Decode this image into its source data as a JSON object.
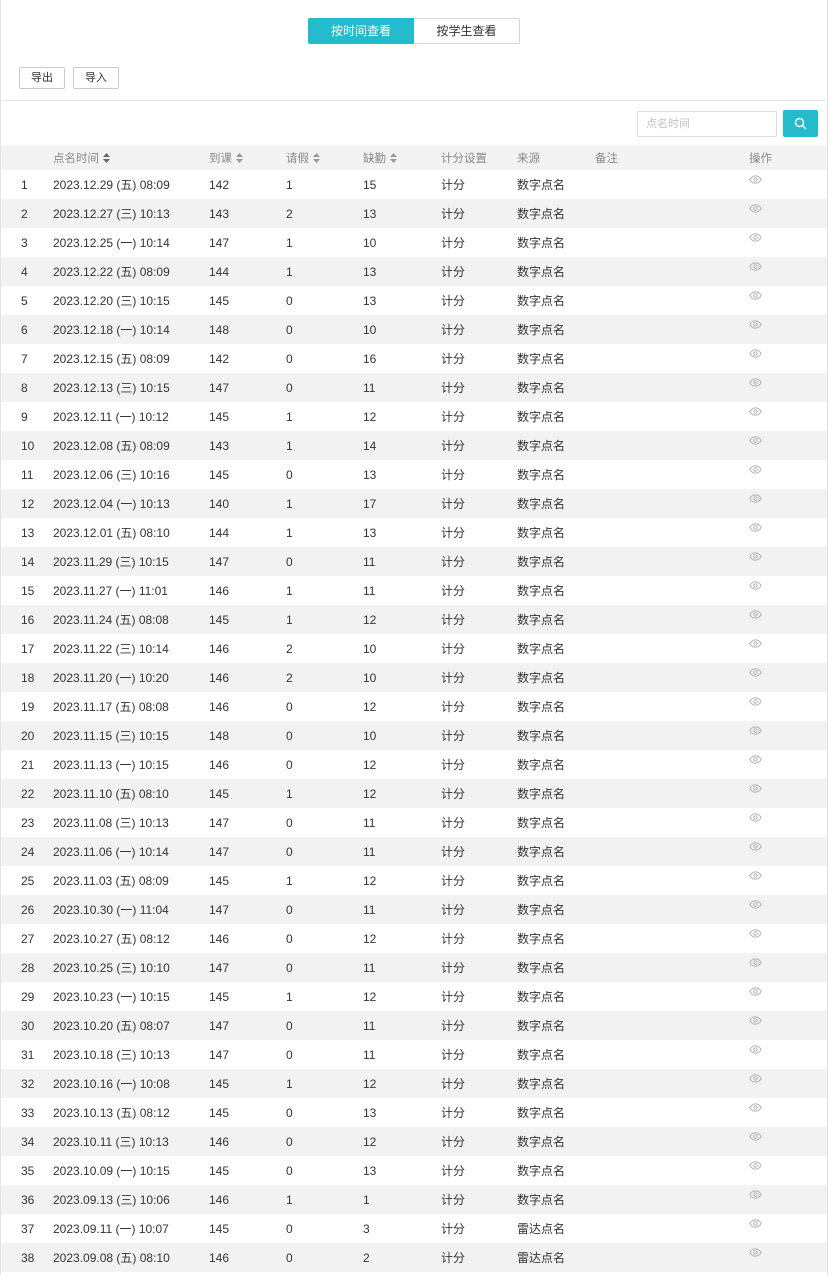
{
  "view_toggle": {
    "by_time": "按时间查看",
    "by_student": "按学生查看"
  },
  "toolbar": {
    "export_label": "导出",
    "import_label": "导入"
  },
  "search": {
    "placeholder": "点名时间"
  },
  "table": {
    "headers": [
      "",
      "点名时间",
      "到课",
      "请假",
      "缺勤",
      "计分设置",
      "来源",
      "备注",
      "操作"
    ],
    "rows": [
      [
        "1",
        "2023.12.29 (五) 08:09",
        "142",
        "1",
        "15",
        "计分",
        "数字点名",
        ""
      ],
      [
        "2",
        "2023.12.27 (三) 10:13",
        "143",
        "2",
        "13",
        "计分",
        "数字点名",
        ""
      ],
      [
        "3",
        "2023.12.25 (一) 10:14",
        "147",
        "1",
        "10",
        "计分",
        "数字点名",
        ""
      ],
      [
        "4",
        "2023.12.22 (五) 08:09",
        "144",
        "1",
        "13",
        "计分",
        "数字点名",
        ""
      ],
      [
        "5",
        "2023.12.20 (三) 10:15",
        "145",
        "0",
        "13",
        "计分",
        "数字点名",
        ""
      ],
      [
        "6",
        "2023.12.18 (一) 10:14",
        "148",
        "0",
        "10",
        "计分",
        "数字点名",
        ""
      ],
      [
        "7",
        "2023.12.15 (五) 08:09",
        "142",
        "0",
        "16",
        "计分",
        "数字点名",
        ""
      ],
      [
        "8",
        "2023.12.13 (三) 10:15",
        "147",
        "0",
        "11",
        "计分",
        "数字点名",
        ""
      ],
      [
        "9",
        "2023.12.11 (一) 10:12",
        "145",
        "1",
        "12",
        "计分",
        "数字点名",
        ""
      ],
      [
        "10",
        "2023.12.08 (五) 08:09",
        "143",
        "1",
        "14",
        "计分",
        "数字点名",
        ""
      ],
      [
        "11",
        "2023.12.06 (三) 10:16",
        "145",
        "0",
        "13",
        "计分",
        "数字点名",
        ""
      ],
      [
        "12",
        "2023.12.04 (一) 10:13",
        "140",
        "1",
        "17",
        "计分",
        "数字点名",
        ""
      ],
      [
        "13",
        "2023.12.01 (五) 08:10",
        "144",
        "1",
        "13",
        "计分",
        "数字点名",
        ""
      ],
      [
        "14",
        "2023.11.29 (三) 10:15",
        "147",
        "0",
        "11",
        "计分",
        "数字点名",
        ""
      ],
      [
        "15",
        "2023.11.27 (一) 11:01",
        "146",
        "1",
        "11",
        "计分",
        "数字点名",
        ""
      ],
      [
        "16",
        "2023.11.24 (五) 08:08",
        "145",
        "1",
        "12",
        "计分",
        "数字点名",
        ""
      ],
      [
        "17",
        "2023.11.22 (三) 10:14",
        "146",
        "2",
        "10",
        "计分",
        "数字点名",
        ""
      ],
      [
        "18",
        "2023.11.20 (一) 10:20",
        "146",
        "2",
        "10",
        "计分",
        "数字点名",
        ""
      ],
      [
        "19",
        "2023.11.17 (五) 08:08",
        "146",
        "0",
        "12",
        "计分",
        "数字点名",
        ""
      ],
      [
        "20",
        "2023.11.15 (三) 10:15",
        "148",
        "0",
        "10",
        "计分",
        "数字点名",
        ""
      ],
      [
        "21",
        "2023.11.13 (一) 10:15",
        "146",
        "0",
        "12",
        "计分",
        "数字点名",
        ""
      ],
      [
        "22",
        "2023.11.10 (五) 08:10",
        "145",
        "1",
        "12",
        "计分",
        "数字点名",
        ""
      ],
      [
        "23",
        "2023.11.08 (三) 10:13",
        "147",
        "0",
        "11",
        "计分",
        "数字点名",
        ""
      ],
      [
        "24",
        "2023.11.06 (一) 10:14",
        "147",
        "0",
        "11",
        "计分",
        "数字点名",
        ""
      ],
      [
        "25",
        "2023.11.03 (五) 08:09",
        "145",
        "1",
        "12",
        "计分",
        "数字点名",
        ""
      ],
      [
        "26",
        "2023.10.30 (一) 11:04",
        "147",
        "0",
        "11",
        "计分",
        "数字点名",
        ""
      ],
      [
        "27",
        "2023.10.27 (五) 08:12",
        "146",
        "0",
        "12",
        "计分",
        "数字点名",
        ""
      ],
      [
        "28",
        "2023.10.25 (三) 10:10",
        "147",
        "0",
        "11",
        "计分",
        "数字点名",
        ""
      ],
      [
        "29",
        "2023.10.23 (一) 10:15",
        "145",
        "1",
        "12",
        "计分",
        "数字点名",
        ""
      ],
      [
        "30",
        "2023.10.20 (五) 08:07",
        "147",
        "0",
        "11",
        "计分",
        "数字点名",
        ""
      ],
      [
        "31",
        "2023.10.18 (三) 10:13",
        "147",
        "0",
        "11",
        "计分",
        "数字点名",
        ""
      ],
      [
        "32",
        "2023.10.16 (一) 10:08",
        "145",
        "1",
        "12",
        "计分",
        "数字点名",
        ""
      ],
      [
        "33",
        "2023.10.13 (五) 08:12",
        "145",
        "0",
        "13",
        "计分",
        "数字点名",
        ""
      ],
      [
        "34",
        "2023.10.11 (三) 10:13",
        "146",
        "0",
        "12",
        "计分",
        "数字点名",
        ""
      ],
      [
        "35",
        "2023.10.09 (一) 10:15",
        "145",
        "0",
        "13",
        "计分",
        "数字点名",
        ""
      ],
      [
        "36",
        "2023.09.13 (三) 10:06",
        "146",
        "1",
        "1",
        "计分",
        "数字点名",
        ""
      ],
      [
        "37",
        "2023.09.11 (一) 10:07",
        "145",
        "0",
        "3",
        "计分",
        "雷达点名",
        ""
      ],
      [
        "38",
        "2023.09.08 (五) 08:10",
        "146",
        "0",
        "2",
        "计分",
        "雷达点名",
        ""
      ]
    ],
    "row_action_icon": "eye-icon"
  },
  "colors": {
    "accent": "#24bccc",
    "row_alt": "#f2f2f2",
    "header_bg": "#f3f3f3"
  }
}
